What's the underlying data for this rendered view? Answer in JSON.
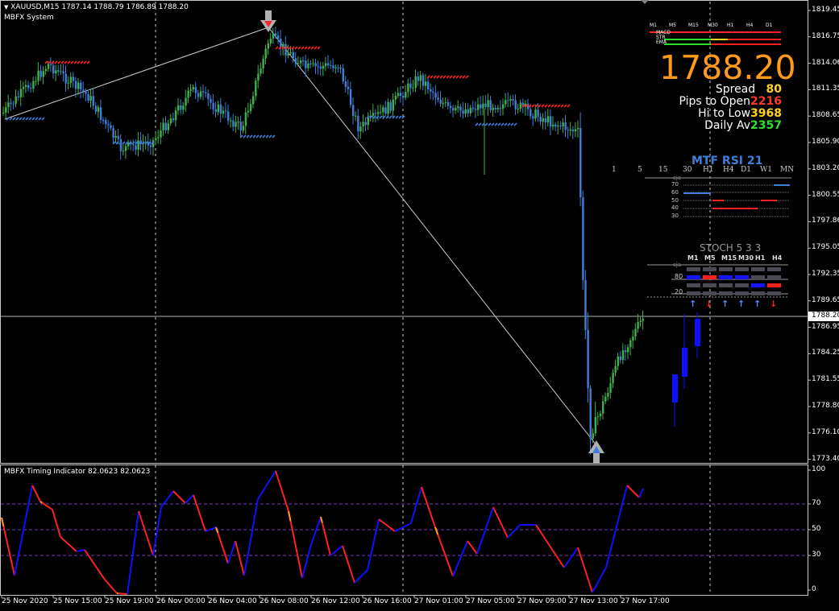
{
  "chart_header": {
    "symbol_line": "XAUUSD,M15  1787.14 1788.79 1786.89 1788.20",
    "system_name": "MBFX System"
  },
  "price_axis": [
    "1819.45",
    "1816.75",
    "1814.06",
    "1811.35",
    "1808.65",
    "1805.90",
    "1803.20",
    "1800.55",
    "1797.86",
    "1795.05",
    "1792.35",
    "1789.65",
    "1786.95",
    "1784.25",
    "1781.55",
    "1778.80",
    "1776.10",
    "1773.40"
  ],
  "current_price_tag": "1788.20",
  "indicator_axis": [
    "100",
    "70",
    "50",
    "30",
    "0"
  ],
  "time_axis": [
    "25 Nov 2020",
    "25 Nov 15:00",
    "25 Nov 19:00",
    "26 Nov 00:00",
    "26 Nov 04:00",
    "26 Nov 08:00",
    "26 Nov 12:00",
    "26 Nov 16:00",
    "27 Nov 01:00",
    "27 Nov 05:00",
    "27 Nov 09:00",
    "27 Nov 13:00",
    "27 Nov 17:00"
  ],
  "info_panel": {
    "trend_timeframes": [
      "M1",
      "M5",
      "M15",
      "M30",
      "H1",
      "H4",
      "D1"
    ],
    "trend_rows": [
      "MACD",
      "STR",
      "EMA"
    ],
    "big_price": "1788.20",
    "spread_label": "Spread",
    "spread_value": "80",
    "pips_open_label": "Pips to Open",
    "pips_open_value": "2216",
    "hi_low_label": "Hi to Low",
    "hi_low_value": "3968",
    "daily_av_label": "Daily Av",
    "daily_av_value": "2357"
  },
  "rsi_panel": {
    "title": "MTF RSI  21",
    "timeframes": [
      "1",
      "5",
      "15",
      "30",
      "H1",
      "H4",
      "D1",
      "W1",
      "MN"
    ],
    "levels": [
      "70",
      "60",
      "50",
      "40",
      "30"
    ]
  },
  "stoch_panel": {
    "title": "STOCH  5 3 3",
    "timeframes": [
      "M1",
      "M5",
      "M15",
      "M30",
      "H1",
      "H4"
    ],
    "levels": [
      "80",
      "20"
    ]
  },
  "indicator": {
    "title": "MBFX Timing Indicator 82.0623 82.0623"
  },
  "colors": {
    "bull": "#3cb44b",
    "bear": "#3d7fd9",
    "red": "#ff2020",
    "orange": "#ff9a1a",
    "blue_line": "#1010ff",
    "grid_dash": "#7a3cc8"
  }
}
